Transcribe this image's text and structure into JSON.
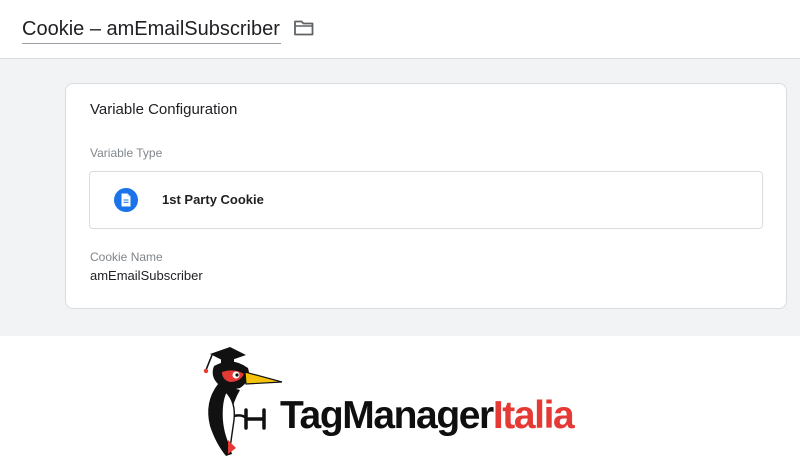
{
  "header": {
    "title": "Cookie – amEmailSubscriber",
    "folder_icon": "folder-icon"
  },
  "card": {
    "title": "Variable Configuration",
    "variable_type_label": "Variable Type",
    "variable_type_value": "1st Party Cookie",
    "variable_type_icon": "document-icon",
    "cookie_name_label": "Cookie Name",
    "cookie_name_value": "amEmailSubscriber"
  },
  "logo": {
    "part1": "TagManager",
    "part2": "Italia",
    "color_primary": "#0f0f0f",
    "color_accent": "#e53935"
  },
  "colors": {
    "accent": "#1a73e8",
    "page_bg": "#f1f3f4"
  }
}
